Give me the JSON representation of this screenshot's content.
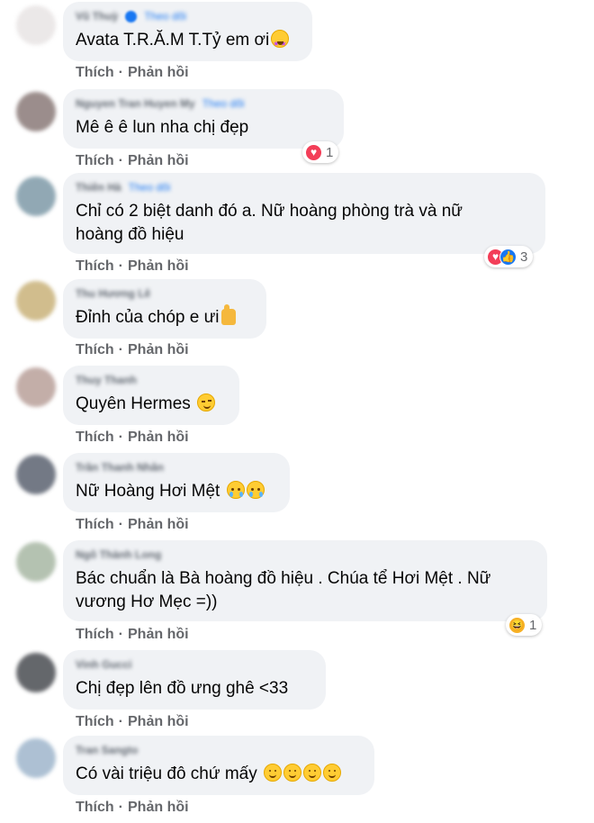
{
  "action_labels": {
    "like": "Thích",
    "reply": "Phản hồi",
    "separator": "·"
  },
  "colors": {
    "bubble": "#f0f2f5",
    "link": "#1877f2",
    "love": "#f33e58",
    "like": "#1877f2",
    "haha": "#f7b125"
  },
  "comments": [
    {
      "name": "Vũ Thuỳ",
      "follow": "Theo dõi",
      "verified": true,
      "text": "Avata T.R.Ă.M T.Tỷ em ơi",
      "emoji_icons": [
        "star-struck-emoji-icon"
      ],
      "reactions": null
    },
    {
      "name": "Nguyen Tran Huyen My",
      "follow": "Theo dõi",
      "text": "Mê ê ê lun nha chị đẹp",
      "reactions": {
        "icons": [
          "love-reaction-icon"
        ],
        "count": "1"
      }
    },
    {
      "name": "Thiên Hà",
      "follow": "Theo dõi",
      "text_lines": [
        "Chỉ có 2 biệt danh đó a. Nữ hoàng phòng trà và nữ",
        "hoàng đồ hiệu"
      ],
      "reactions": {
        "icons": [
          "love-reaction-icon",
          "like-reaction-icon"
        ],
        "count": "3"
      }
    },
    {
      "name": "Thu Hương Lê",
      "text": "Đỉnh của chóp e ưi",
      "emoji_icons": [
        "thumbs-up-emoji-icon"
      ]
    },
    {
      "name": "Thuy Thanh",
      "text": "Quyên Hermes",
      "emoji_icons": [
        "winking-face-emoji-icon"
      ]
    },
    {
      "name": "Trần Thanh Nhân",
      "text": "Nữ Hoàng Hơi Mệt",
      "emoji_icons": [
        "tearful-face-emoji-icon",
        "tearful-face-emoji-icon"
      ]
    },
    {
      "name": "Ngô Thành Long",
      "text_lines": [
        "Bác chuẩn là Bà hoàng đồ hiệu . Chúa tể Hơi Mệt . Nữ",
        "vương Hơ Mẹc =))"
      ],
      "reactions": {
        "icons": [
          "haha-reaction-icon"
        ],
        "count": "1"
      }
    },
    {
      "name": "Vinh Gucci",
      "text": "Chị đẹp lên đồ ưng ghê <33"
    },
    {
      "name": "Tran Sangto",
      "text": "Có vài triệu đô chứ mấy",
      "emoji_icons": [
        "smiling-face-emoji-icon",
        "smiling-face-emoji-icon",
        "smiling-face-emoji-icon",
        "smiling-face-emoji-icon"
      ]
    }
  ]
}
